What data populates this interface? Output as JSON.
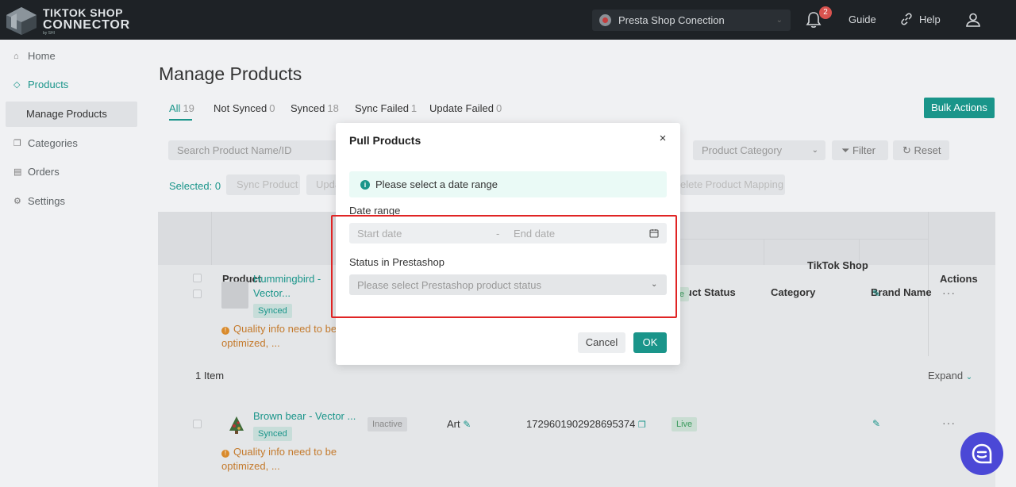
{
  "header": {
    "logo_line1": "TIKTOK SHOP",
    "logo_line2": "CONNECTOR",
    "logo_line3": "by SHI",
    "shop_name": "Presta Shop Conection",
    "notification_count": "2",
    "guide_label": "Guide",
    "help_label": "Help"
  },
  "sidebar": {
    "items": [
      {
        "label": "Home",
        "icon": "home-icon"
      },
      {
        "label": "Products",
        "icon": "tag-icon"
      },
      {
        "label": "Manage Products"
      },
      {
        "label": "Categories",
        "icon": "copy-icon"
      },
      {
        "label": "Orders",
        "icon": "box-icon"
      },
      {
        "label": "Settings",
        "icon": "gear-icon"
      }
    ]
  },
  "main": {
    "title": "Manage Products",
    "tabs": [
      {
        "label": "All",
        "count": "19"
      },
      {
        "label": "Not Synced",
        "count": "0"
      },
      {
        "label": "Synced",
        "count": "18"
      },
      {
        "label": "Sync Failed",
        "count": "1"
      },
      {
        "label": "Update Failed",
        "count": "0"
      }
    ],
    "bulk_actions": "Bulk Actions",
    "search_placeholder": "Search Product Name/ID",
    "category_placeholder": "Product Category",
    "filter_label": "Filter",
    "reset_label": "Reset",
    "selected_label": "Selected: 0",
    "sync_product": "Sync Product",
    "update_partial": "Upda",
    "delete_mapping": "elete Product Mapping",
    "table": {
      "product_header": "Product",
      "tiktok_shop_header": "TikTok Shop",
      "product_status_header": "oduct Status",
      "category_header": "Category",
      "brand_header": "Brand Name",
      "actions_header": "Actions",
      "rows": [
        {
          "name_line1": "Hummingbird -",
          "name_line2": "Vector...",
          "tag": "Synced",
          "warn_line1": "Quality info need to be",
          "warn_line2": "optimized, ...",
          "tiktok_status": "ive"
        },
        {
          "name_line1": "Brown bear - Vector ...",
          "tag": "Synced",
          "warn_line1": "Quality info need to be",
          "warn_line2": "optimized, ...",
          "presta_status": "Inactive",
          "category": "Art",
          "id": "1729601902928695374",
          "tiktok_status": "Live"
        }
      ],
      "item_count": "1 Item",
      "expand_label": "Expand"
    }
  },
  "modal": {
    "title": "Pull Products",
    "info": "Please select a date range",
    "date_range_label": "Date range",
    "start_placeholder": "Start date",
    "separator": "-",
    "end_placeholder": "End date",
    "status_label": "Status in Prestashop",
    "status_placeholder": "Please select Prestashop product status",
    "cancel": "Cancel",
    "ok": "OK"
  },
  "colors": {
    "accent": "#1a958a",
    "header_bg": "#1e2226",
    "highlight": "#e02424",
    "chat_fab": "#4b48d6"
  }
}
